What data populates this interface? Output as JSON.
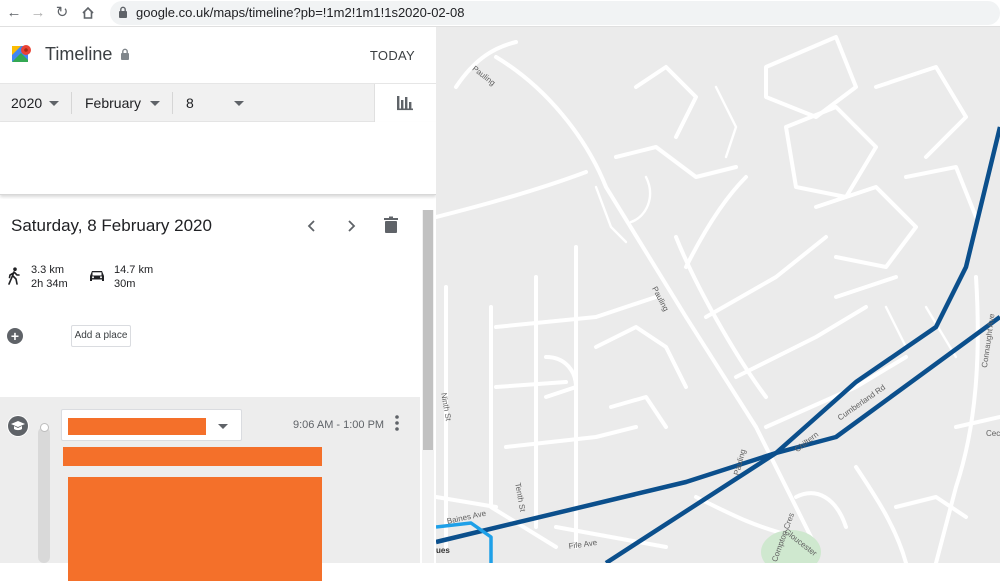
{
  "browser": {
    "url": "google.co.uk/maps/timeline?pb=!1m2!1m1!1s2020-02-08"
  },
  "header": {
    "title": "Timeline",
    "today_label": "TODAY"
  },
  "date_selector": {
    "year": "2020",
    "month": "February",
    "day": "8"
  },
  "day": {
    "title": "Saturday, 8 February 2020",
    "walking": {
      "distance": "3.3 km",
      "duration": "2h 34m"
    },
    "driving": {
      "distance": "14.7 km",
      "duration": "30m"
    },
    "add_place_label": "Add a place"
  },
  "segment": {
    "time_range": "9:06 AM - 1:00 PM"
  },
  "map": {
    "labels": {
      "pauling_top": "Pauling",
      "pauling_mid": "Pauling",
      "pauling_low": "Pauling",
      "ninth_st": "Ninth St",
      "tenth_st": "Tenth St",
      "baines_ave": "Baines Ave",
      "fife_ave": "Fife Ave",
      "chiltern": "Chiltern",
      "cumberland_rd": "Cumberland Rd",
      "connaught_ave": "Connaught Ave",
      "cec": "Cec",
      "gloucester": "Gloucester",
      "compton_cres": "Compton Cres",
      "ues": "ues"
    },
    "colors": {
      "route": "#0b4f8c",
      "walk_route": "#1ea0e8",
      "park": "#cfe8cf"
    }
  }
}
